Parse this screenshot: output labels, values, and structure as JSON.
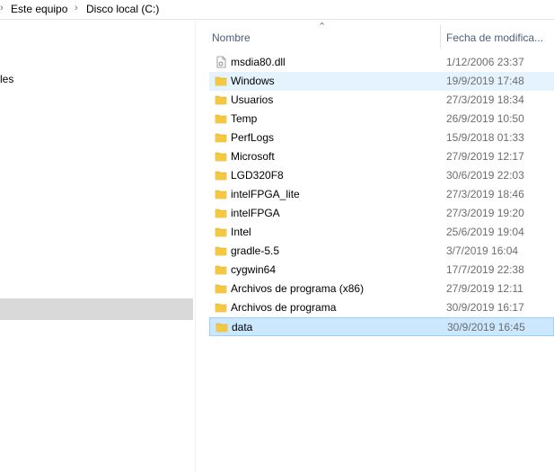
{
  "breadcrumb": {
    "items": [
      "Este equipo",
      "Disco local (C:)"
    ]
  },
  "sidebar": {
    "partial_label": "les"
  },
  "columns": {
    "name": "Nombre",
    "date": "Fecha de modifica..."
  },
  "files": [
    {
      "name": "msdia80.dll",
      "date": "1/12/2006 23:37",
      "type": "file"
    },
    {
      "name": "Windows",
      "date": "19/9/2019 17:48",
      "type": "folder",
      "state": "hover"
    },
    {
      "name": "Usuarios",
      "date": "27/3/2019 18:34",
      "type": "folder"
    },
    {
      "name": "Temp",
      "date": "26/9/2019 10:50",
      "type": "folder"
    },
    {
      "name": "PerfLogs",
      "date": "15/9/2018 01:33",
      "type": "folder"
    },
    {
      "name": "Microsoft",
      "date": "27/9/2019 12:17",
      "type": "folder"
    },
    {
      "name": "LGD320F8",
      "date": "30/6/2019 22:03",
      "type": "folder"
    },
    {
      "name": "intelFPGA_lite",
      "date": "27/3/2019 18:46",
      "type": "folder"
    },
    {
      "name": "intelFPGA",
      "date": "27/3/2019 19:20",
      "type": "folder"
    },
    {
      "name": "Intel",
      "date": "25/6/2019 19:04",
      "type": "folder"
    },
    {
      "name": "gradle-5.5",
      "date": "3/7/2019 16:04",
      "type": "folder"
    },
    {
      "name": "cygwin64",
      "date": "17/7/2019 22:38",
      "type": "folder"
    },
    {
      "name": "Archivos de programa (x86)",
      "date": "27/9/2019 12:11",
      "type": "folder"
    },
    {
      "name": "Archivos de programa",
      "date": "30/9/2019 16:17",
      "type": "folder"
    },
    {
      "name": "data",
      "date": "30/9/2019 16:45",
      "type": "folder",
      "state": "selected"
    }
  ],
  "colors": {
    "folder": "#f5c842",
    "hover": "#e5f3ff",
    "selected": "#cce8ff",
    "selected_border": "#99d1ff",
    "header_text": "#4c607a"
  }
}
